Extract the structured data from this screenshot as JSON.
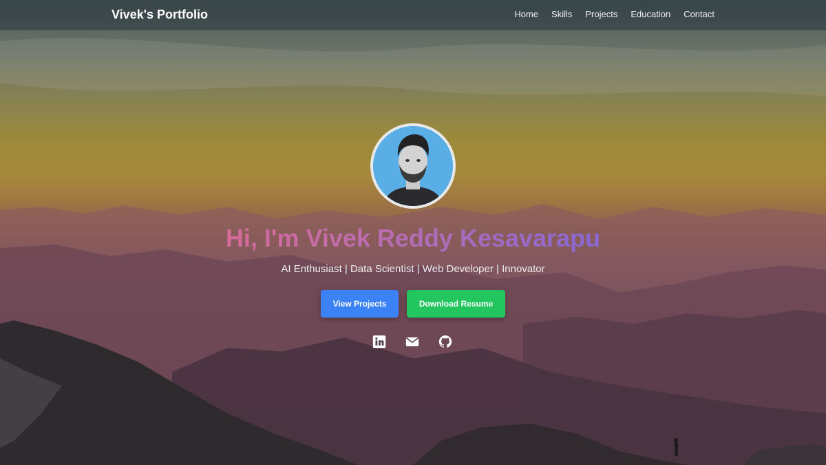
{
  "navbar": {
    "brand": "Vivek's Portfolio",
    "links": [
      "Home",
      "Skills",
      "Projects",
      "Education",
      "Contact"
    ]
  },
  "hero": {
    "headline": "Hi, I'm Vivek Reddy Kesavarapu",
    "tagline": "AI Enthusiast | Data Scientist | Web Developer | Innovator",
    "buttons": {
      "projects": "View Projects",
      "resume": "Download Resume"
    },
    "social_icons": [
      "linkedin-icon",
      "email-icon",
      "github-icon"
    ]
  },
  "colors": {
    "primary_button": "#3b82f6",
    "secondary_button": "#22c55e",
    "headline_gradient_start": "#d66a97",
    "headline_gradient_end": "#8868d4"
  }
}
